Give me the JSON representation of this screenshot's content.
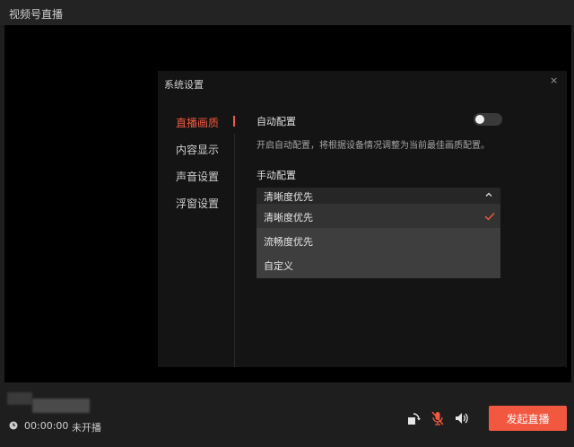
{
  "window": {
    "title": "视频号直播"
  },
  "bottom": {
    "time": "00:00:00",
    "status": "未开播",
    "live_button": "发起直播"
  },
  "dialog": {
    "title": "系统设置",
    "close_glyph": "×",
    "nav": [
      {
        "label": "直播画质",
        "active": true
      },
      {
        "label": "内容显示",
        "active": false
      },
      {
        "label": "声音设置",
        "active": false
      },
      {
        "label": "浮窗设置",
        "active": false
      }
    ],
    "auto_config": {
      "label": "自动配置",
      "enabled": false,
      "description": "开启自动配置，将根据设备情况调整为当前最佳画质配置。"
    },
    "manual_config": {
      "label": "手动配置",
      "selected": "清晰度优先",
      "options": [
        "清晰度优先",
        "流畅度优先",
        "自定义"
      ]
    }
  },
  "colors": {
    "accent": "#f2573f",
    "background": "#1e1e1e",
    "dialog_bg": "#141414"
  },
  "icons": [
    "clock-icon",
    "rotate-icon",
    "mic-muted-icon",
    "speaker-icon",
    "chevron-up-icon",
    "check-icon",
    "close-icon"
  ]
}
